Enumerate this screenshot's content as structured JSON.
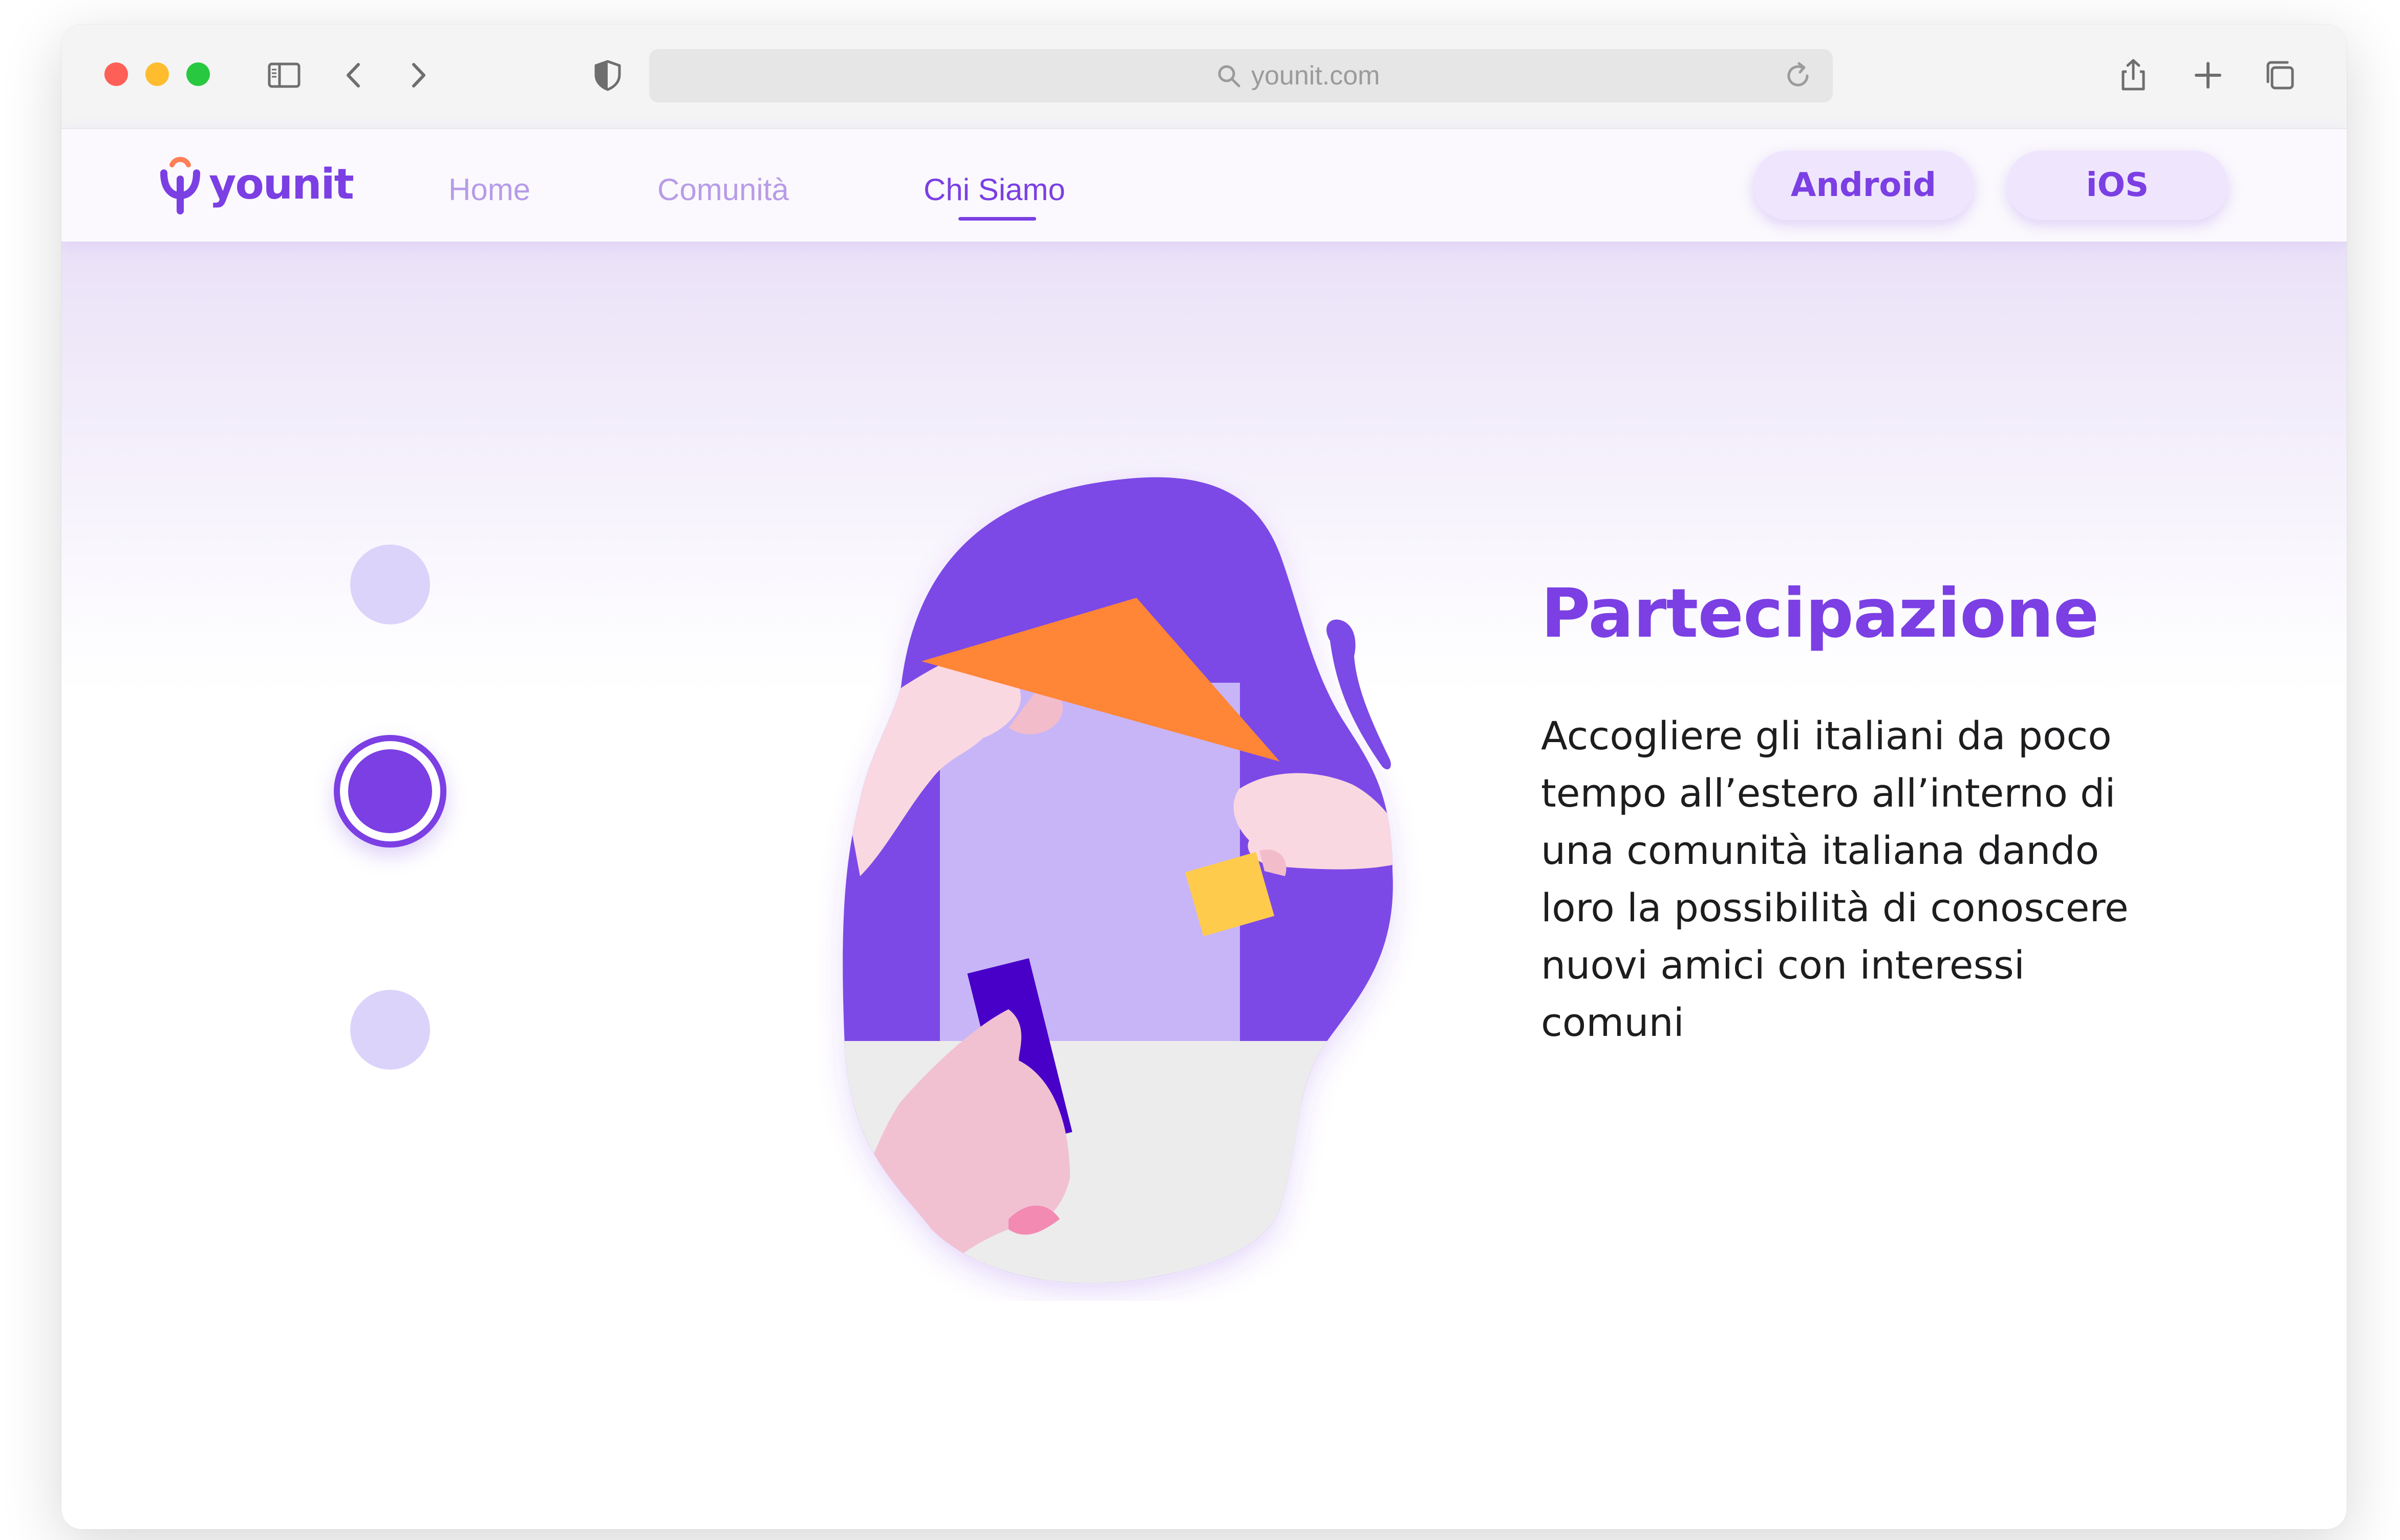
{
  "browser": {
    "url": "younit.com"
  },
  "site": {
    "logo_text": "younit",
    "nav": [
      {
        "label": "Home",
        "active": false
      },
      {
        "label": "Comunità",
        "active": false
      },
      {
        "label": "Chi Siamo",
        "active": true
      }
    ],
    "buttons": {
      "android": "Android",
      "ios": "iOS"
    },
    "carousel": {
      "total_slides": 3,
      "active_slide": 2
    },
    "slide": {
      "title": "Partecipazione",
      "body": "Accogliere gli italiani da poco tempo all’estero all’interno di una comunità italiana dando loro la possibilità di conoscere nuovi amici con interessi comuni"
    }
  },
  "colors": {
    "brand": "#7b3fe4",
    "nav_inactive": "#b79ce8",
    "button_bg": "#efe6fd",
    "dot_inactive": "#dcd3fb"
  }
}
